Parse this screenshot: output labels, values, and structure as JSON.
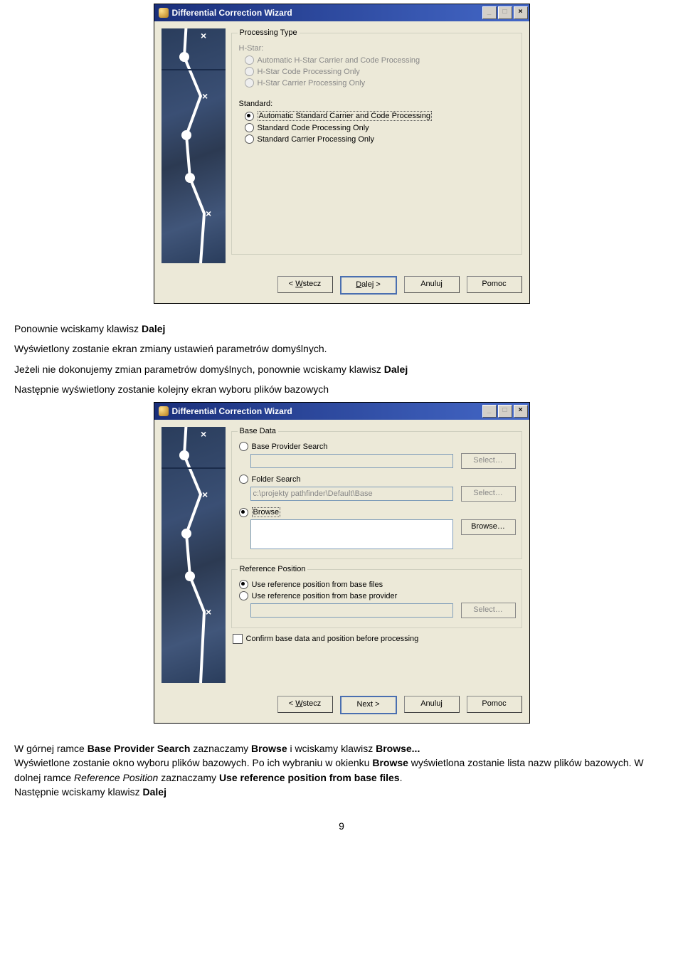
{
  "dialog1": {
    "title": "Differential Correction Wizard",
    "group_legend": "Processing Type",
    "hstar_label": "H-Star:",
    "hstar_options": [
      "Automatic H-Star Carrier and Code Processing",
      "H-Star Code Processing Only",
      "H-Star Carrier Processing Only"
    ],
    "standard_label": "Standard:",
    "standard_options": [
      "Automatic Standard Carrier and Code Processing",
      "Standard Code Processing Only",
      "Standard Carrier Processing Only"
    ],
    "buttons": {
      "back": "< Wstecz",
      "next": "Dalej >",
      "cancel": "Anuluj",
      "help": "Pomoc"
    }
  },
  "text1": {
    "p1a": "Ponownie wciskamy klawisz ",
    "p1b": "Dalej",
    "p2": "Wyświetlony zostanie ekran zmiany ustawień parametrów domyślnych.",
    "p3a": "Jeżeli nie dokonujemy zmian parametrów domyślnych, ponownie wciskamy klawisz ",
    "p3b": "Dalej",
    "p4": "Następnie wyświetlony zostanie kolejny ekran wyboru plików bazowych"
  },
  "dialog2": {
    "title": "Differential Correction Wizard",
    "basedata_legend": "Base Data",
    "opt_provider": "Base Provider Search",
    "opt_folder": "Folder Search",
    "folder_path": "c:\\projekty pathfinder\\Default\\Base",
    "opt_browse": "Browse",
    "btn_select": "Select…",
    "btn_browse": "Browse…",
    "refpos_legend": "Reference Position",
    "ref_opt1": "Use reference position from base files",
    "ref_opt2": "Use reference position from base provider",
    "confirm_label": "Confirm base data and position before processing",
    "buttons": {
      "back": "< Wstecz",
      "next": "Next  >",
      "cancel": "Anuluj",
      "help": "Pomoc"
    }
  },
  "text2": {
    "l1a": "W górnej ramce ",
    "l1b": "Base Provider Search",
    "l1c": " zaznaczamy ",
    "l1d": "Browse",
    "l1e": " i wciskamy klawisz ",
    "l1f": "Browse...",
    "l2a": "Wyświetlone zostanie okno wyboru plików bazowych. Po ich wybraniu w okienku ",
    "l2b": "Browse",
    "l2c": " wyświetlona zostanie lista nazw plików bazowych. W dolnej ramce ",
    "l2d": "Reference Position",
    "l2e": " zaznaczamy ",
    "l2f": "Use reference position from base files",
    "l2g": ".",
    "l3a": "Następnie wciskamy klawisz ",
    "l3b": "Dalej"
  },
  "page_number": "9"
}
